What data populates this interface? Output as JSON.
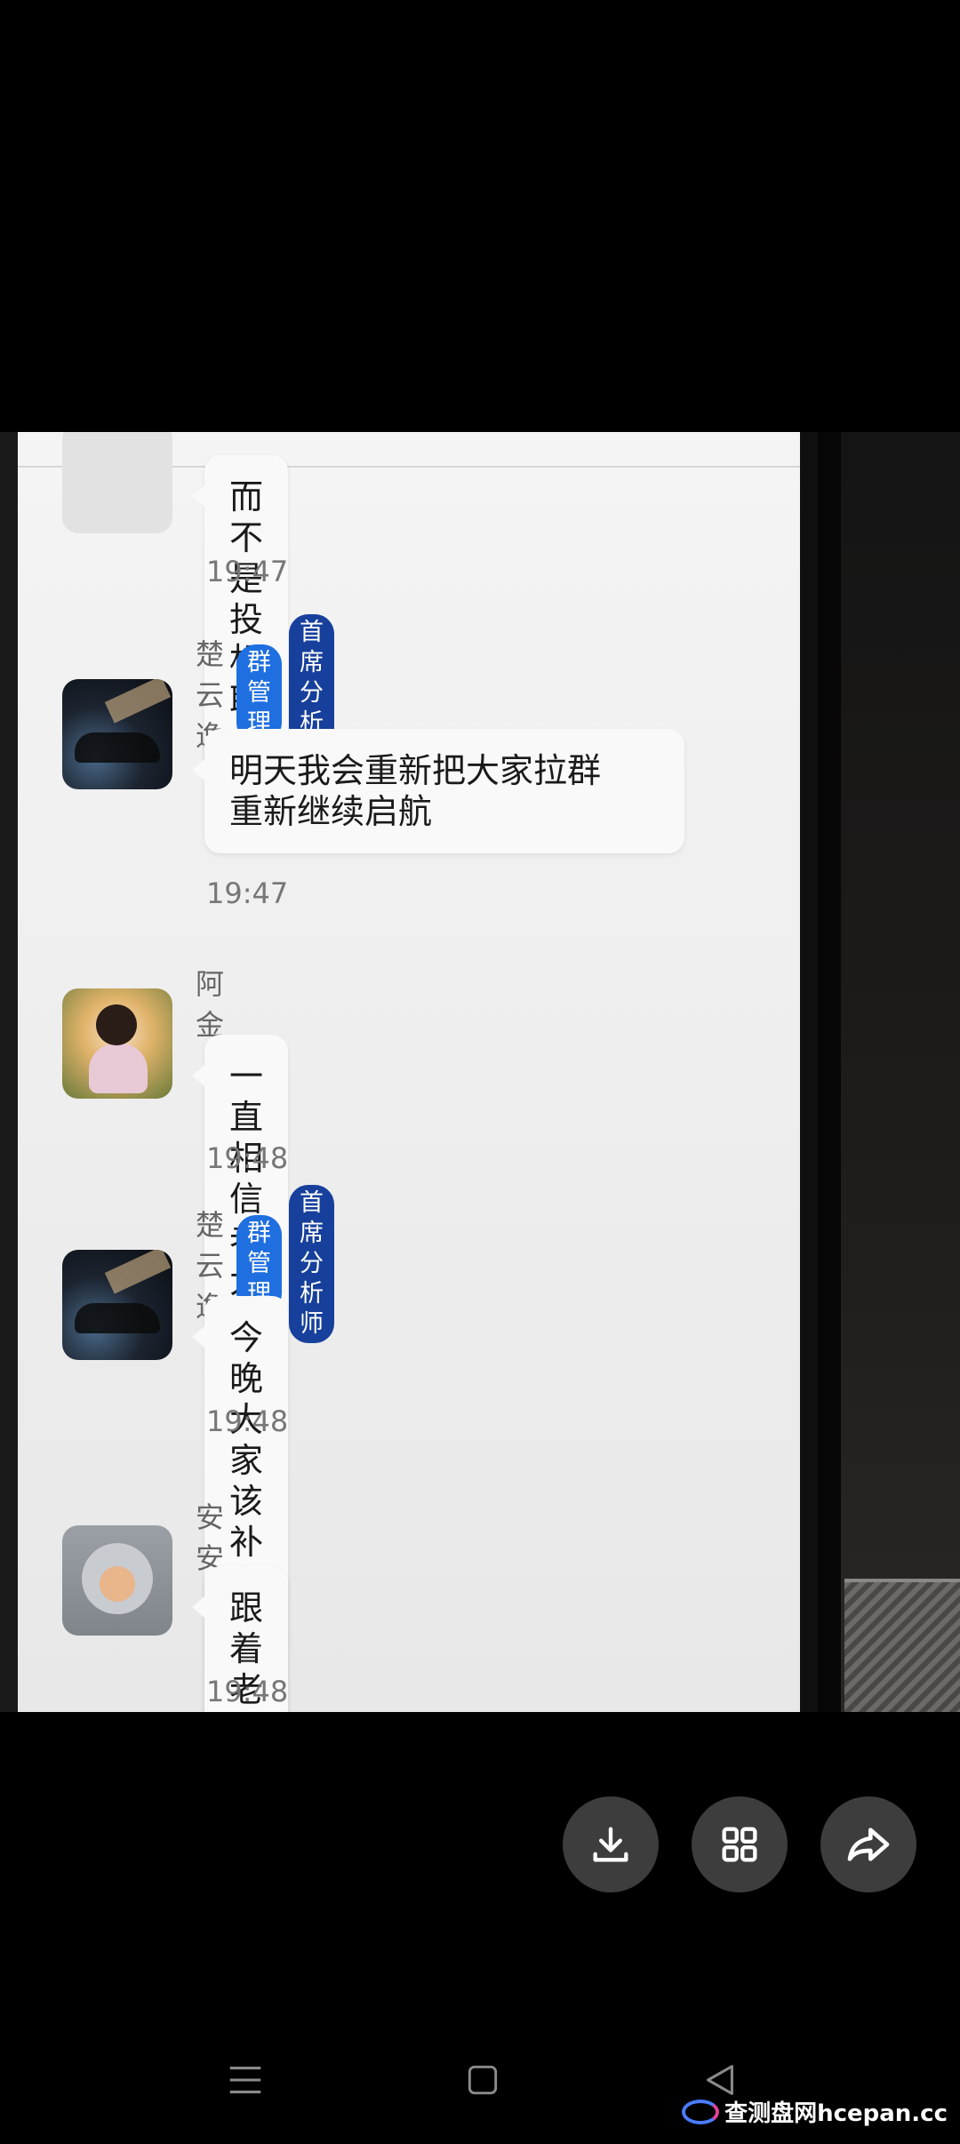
{
  "chat": {
    "messages": [
      {
        "sender": "",
        "badges": [],
        "text_lines": [
          "而不是投机取巧"
        ],
        "time": "19:47",
        "avatar": "avatar-placeholder"
      },
      {
        "sender": "楚云逸",
        "badges": [
          "群管理",
          "首席分析师"
        ],
        "text_lines": [
          "明天我会重新把大家拉群",
          "重新继续启航"
        ],
        "time": "19:47",
        "avatar": "car-avatar"
      },
      {
        "sender": "阿金",
        "badges": [],
        "text_lines": [
          "一直相信老大"
        ],
        "time": "19:48",
        "avatar": "girl-avatar"
      },
      {
        "sender": "楚云逸",
        "badges": [
          "群管理",
          "首席分析师"
        ],
        "text_lines": [
          "今晚大家该补仓的补仓"
        ],
        "time": "19:48",
        "avatar": "car-avatar"
      },
      {
        "sender": "安安",
        "badges": [],
        "text_lines": [
          "跟着老大走"
        ],
        "time": "19:48",
        "avatar": "cat-hood-avatar"
      }
    ]
  },
  "actions": {
    "download_icon": "download-icon",
    "grid_icon": "grid-icon",
    "share_icon": "share-icon"
  },
  "navbar": {
    "menu_icon": "menu-icon",
    "home_icon": "home-square-icon",
    "back_icon": "back-triangle-icon"
  },
  "watermark": {
    "text": "查测盘网hcepan.cc"
  },
  "colors": {
    "badge_admin": "#1f6fe0",
    "badge_analyst": "#17409c",
    "background": "#000000",
    "button_bg": "#3d3d3d"
  }
}
